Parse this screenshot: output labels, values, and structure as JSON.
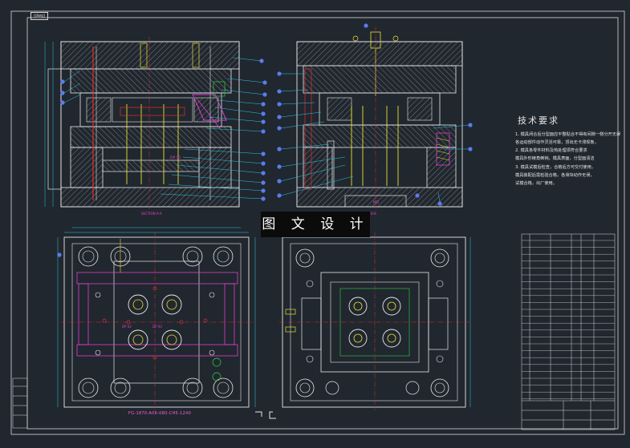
{
  "drawing": {
    "corner_tag": "(dwg)",
    "watermark": "图 文 设 计",
    "technical_requirements": {
      "title": "技术要求",
      "lines": [
        "1. 模具闭合后分型面应平整贴合不得有间隙一侧分开无误",
        "   各运动部件动作灵活可靠，顶出无卡滞现象，",
        "2. 模具各零件材料及热处理须符合要求",
        "   模具外形棱角倒钝，模具表面，分型面清洁",
        "3. 模具试模后检查，合格后方可交付使用，",
        "   模具装配后需检验合格，各滑块动作无误，",
        "   试模合格，出厂使用。"
      ]
    },
    "annotations": {
      "part_number": "FG-1870-A06-080-CH5-1240",
      "section_label_left": "SECTION A-A",
      "section_label_right": "B-B",
      "dim_label_1": "DP 01",
      "dim_label_2": "DP 02",
      "dim_label_3": "KO",
      "dim_label_4": "DP 03"
    },
    "colors": {
      "background": "#21272f",
      "frame": "#d9d9d9",
      "outline": "#e8e8e8",
      "hatch": "#b8b8b8",
      "leader": "#28c8e6",
      "balloon": "#5a7cf0",
      "magenta": "#e040d0",
      "yellow": "#e8e030",
      "red": "#e03030",
      "green": "#30d040",
      "cyan": "#30d8d8"
    }
  }
}
